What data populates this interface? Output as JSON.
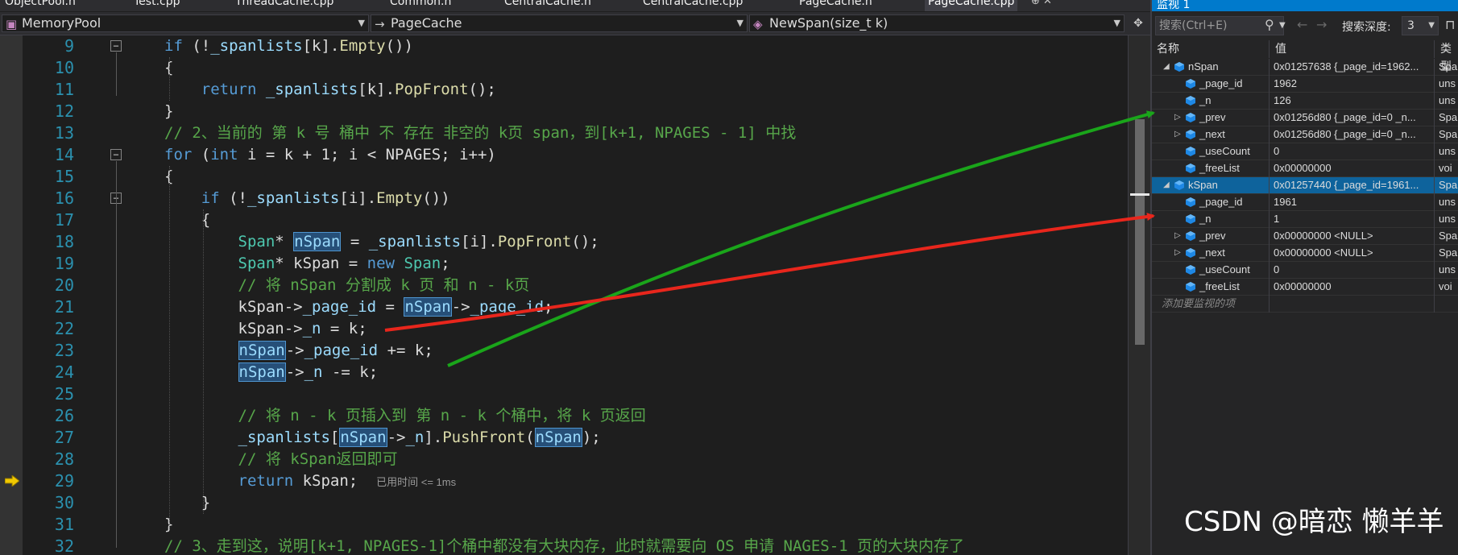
{
  "tabs": [
    "ObjectPool.h",
    "Test.cpp",
    "ThreadCache.cpp",
    "Common.h",
    "CentralCache.h",
    "CentralCache.cpp",
    "PageCache.h",
    "PageCache.cpp"
  ],
  "tab_extra": "⊕ ✕",
  "navbar": {
    "project": "MemoryPool",
    "scope": "PageCache",
    "member": "NewSpan(size_t k)"
  },
  "code_lines": [
    {
      "n": "9",
      "tokens": [
        [
          "k",
          "if"
        ],
        [
          "p",
          " (!"
        ],
        [
          "v",
          "_spanlists"
        ],
        [
          "p",
          "[k]."
        ],
        [
          "f",
          "Empty"
        ],
        [
          "p",
          "())"
        ]
      ]
    },
    {
      "n": "10",
      "tokens": [
        [
          "p",
          "{"
        ]
      ]
    },
    {
      "n": "11",
      "tokens": [
        [
          "p",
          "    "
        ],
        [
          "k",
          "return"
        ],
        [
          "p",
          " "
        ],
        [
          "v",
          "_spanlists"
        ],
        [
          "p",
          "[k]."
        ],
        [
          "f",
          "PopFront"
        ],
        [
          "p",
          "();"
        ]
      ]
    },
    {
      "n": "12",
      "tokens": [
        [
          "p",
          "}"
        ]
      ]
    },
    {
      "n": "13",
      "tokens": [
        [
          "c",
          "// 2、当前的 第 k 号 桶中 不 存在 非空的 k页 span，到[k+1, NPAGES - 1] 中找"
        ]
      ]
    },
    {
      "n": "14",
      "tokens": [
        [
          "k",
          "for"
        ],
        [
          "p",
          " ("
        ],
        [
          "k",
          "int"
        ],
        [
          "p",
          " i = k + 1; i < NPAGES; i++)"
        ]
      ]
    },
    {
      "n": "15",
      "tokens": [
        [
          "p",
          "{"
        ]
      ]
    },
    {
      "n": "16",
      "tokens": [
        [
          "p",
          "    "
        ],
        [
          "k",
          "if"
        ],
        [
          "p",
          " (!"
        ],
        [
          "v",
          "_spanlists"
        ],
        [
          "p",
          "[i]."
        ],
        [
          "f",
          "Empty"
        ],
        [
          "p",
          "())"
        ]
      ]
    },
    {
      "n": "17",
      "tokens": [
        [
          "p",
          "    {"
        ]
      ]
    },
    {
      "n": "18",
      "tokens": [
        [
          "p",
          "        "
        ],
        [
          "t",
          "Span"
        ],
        [
          "p",
          "* "
        ],
        [
          "h",
          "nSpan"
        ],
        [
          "p",
          " = "
        ],
        [
          "v",
          "_spanlists"
        ],
        [
          "p",
          "[i]."
        ],
        [
          "f",
          "PopFront"
        ],
        [
          "p",
          "();"
        ]
      ]
    },
    {
      "n": "19",
      "tokens": [
        [
          "p",
          "        "
        ],
        [
          "t",
          "Span"
        ],
        [
          "p",
          "* kSpan = "
        ],
        [
          "k",
          "new"
        ],
        [
          "p",
          " "
        ],
        [
          "t",
          "Span"
        ],
        [
          "p",
          ";"
        ]
      ]
    },
    {
      "n": "20",
      "tokens": [
        [
          "p",
          "        "
        ],
        [
          "c",
          "// 将 nSpan 分割成 k 页 和 n - k页"
        ]
      ]
    },
    {
      "n": "21",
      "tokens": [
        [
          "p",
          "        kSpan->"
        ],
        [
          "v",
          "_page_id"
        ],
        [
          "p",
          " = "
        ],
        [
          "h",
          "nSpan"
        ],
        [
          "p",
          "->"
        ],
        [
          "v",
          "_page_id"
        ],
        [
          "p",
          ";"
        ]
      ]
    },
    {
      "n": "22",
      "tokens": [
        [
          "p",
          "        kSpan->"
        ],
        [
          "v",
          "_n"
        ],
        [
          "p",
          " = k;"
        ]
      ]
    },
    {
      "n": "23",
      "tokens": [
        [
          "p",
          "        "
        ],
        [
          "h",
          "nSpan"
        ],
        [
          "p",
          "->"
        ],
        [
          "v",
          "_page_id"
        ],
        [
          "p",
          " += k;"
        ]
      ]
    },
    {
      "n": "24",
      "tokens": [
        [
          "p",
          "        "
        ],
        [
          "h",
          "nSpan"
        ],
        [
          "p",
          "->"
        ],
        [
          "v",
          "_n"
        ],
        [
          "p",
          " -= k;"
        ]
      ]
    },
    {
      "n": "25",
      "tokens": []
    },
    {
      "n": "26",
      "tokens": [
        [
          "p",
          "        "
        ],
        [
          "c",
          "// 将 n - k 页插入到 第 n - k 个桶中，将 k 页返回"
        ]
      ]
    },
    {
      "n": "27",
      "tokens": [
        [
          "p",
          "        "
        ],
        [
          "v",
          "_spanlists"
        ],
        [
          "p",
          "["
        ],
        [
          "h",
          "nSpan"
        ],
        [
          "p",
          "->"
        ],
        [
          "v",
          "_n"
        ],
        [
          "p",
          "]."
        ],
        [
          "f",
          "PushFront"
        ],
        [
          "p",
          "("
        ],
        [
          "h",
          "nSpan"
        ],
        [
          "p",
          ");"
        ]
      ]
    },
    {
      "n": "28",
      "tokens": [
        [
          "p",
          "        "
        ],
        [
          "c",
          "// 将 kSpan返回即可"
        ]
      ]
    },
    {
      "n": "29",
      "tokens": [
        [
          "p",
          "        "
        ],
        [
          "k",
          "return"
        ],
        [
          "p",
          " kSpan;  "
        ],
        [
          "e",
          "已用时间 <= 1ms"
        ]
      ]
    },
    {
      "n": "30",
      "tokens": [
        [
          "p",
          "    }"
        ]
      ]
    },
    {
      "n": "31",
      "tokens": [
        [
          "p",
          "}"
        ]
      ]
    },
    {
      "n": "32",
      "tokens": [
        [
          "c",
          "// 3、走到这，说明[k+1, NPAGES-1]个桶中都没有大块内存，此时就需要向 OS 申请 NAGES-1 页的大块内存了"
        ]
      ]
    }
  ],
  "watch": {
    "title": "监视 1",
    "search_placeholder": "搜索(Ctrl+E)",
    "depth_label": "搜索深度:",
    "depth_value": "3",
    "col_name": "名称",
    "col_value": "值",
    "col_type": "类型",
    "rows": [
      {
        "name": "nSpan",
        "value": "0x01257638 {_page_id=1962...",
        "type": "Spa",
        "level": 0,
        "expander": "◢"
      },
      {
        "name": "_page_id",
        "value": "1962",
        "type": "uns",
        "level": 1,
        "expander": ""
      },
      {
        "name": "_n",
        "value": "126",
        "type": "uns",
        "level": 1,
        "expander": ""
      },
      {
        "name": "_prev",
        "value": "0x01256d80 {_page_id=0 _n...",
        "type": "Spa",
        "level": 1,
        "expander": "▷"
      },
      {
        "name": "_next",
        "value": "0x01256d80 {_page_id=0 _n...",
        "type": "Spa",
        "level": 1,
        "expander": "▷"
      },
      {
        "name": "_useCount",
        "value": "0",
        "type": "uns",
        "level": 1,
        "expander": ""
      },
      {
        "name": "_freeList",
        "value": "0x00000000",
        "type": "voi",
        "level": 1,
        "expander": ""
      },
      {
        "name": "kSpan",
        "value": "0x01257440 {_page_id=1961...",
        "type": "Spa",
        "level": 0,
        "expander": "◢",
        "selected": true
      },
      {
        "name": "_page_id",
        "value": "1961",
        "type": "uns",
        "level": 1,
        "expander": ""
      },
      {
        "name": "_n",
        "value": "1",
        "type": "uns",
        "level": 1,
        "expander": ""
      },
      {
        "name": "_prev",
        "value": "0x00000000 <NULL>",
        "type": "Spa",
        "level": 1,
        "expander": "▷"
      },
      {
        "name": "_next",
        "value": "0x00000000 <NULL>",
        "type": "Spa",
        "level": 1,
        "expander": "▷"
      },
      {
        "name": "_useCount",
        "value": "0",
        "type": "uns",
        "level": 1,
        "expander": ""
      },
      {
        "name": "_freeList",
        "value": "0x00000000",
        "type": "voi",
        "level": 1,
        "expander": ""
      }
    ],
    "add_watch": "添加要监视的项"
  },
  "watermark": "CSDN @暗恋 懒羊羊",
  "colors": {
    "green_arrow": "#1aa51a",
    "red_arrow": "#e8261c",
    "accent": "#007acc"
  }
}
